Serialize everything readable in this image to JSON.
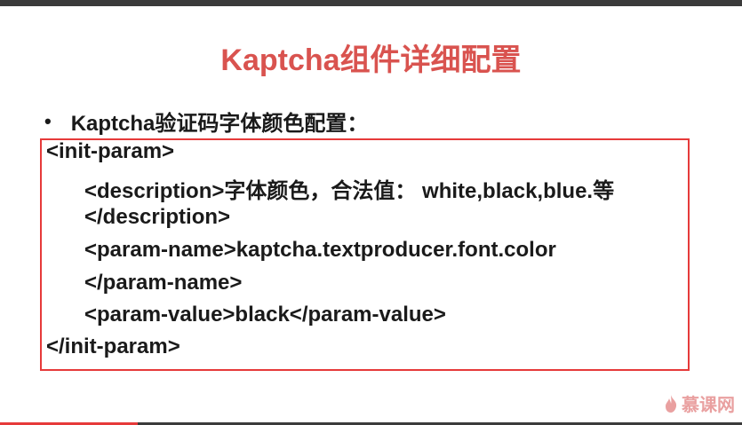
{
  "slide": {
    "title": "Kaptcha组件详细配置",
    "bullet": "Kaptcha验证码字体颜色配置：",
    "bullet_marker": "•"
  },
  "code": {
    "lines": [
      "<init-param>",
      "<description>字体颜色，合法值： white,black,blue.等",
      "</description>",
      "<param-name>kaptcha.textproducer.font.color",
      "</param-name>",
      "<param-value>black</param-value>",
      "</init-param>"
    ]
  },
  "logo": {
    "text": "慕课网",
    "icon": "flame-icon"
  },
  "colors": {
    "title": "#d9534f",
    "box_border": "#e63a3a",
    "text": "#1a1a1a",
    "logo": "#e9a0a0"
  }
}
